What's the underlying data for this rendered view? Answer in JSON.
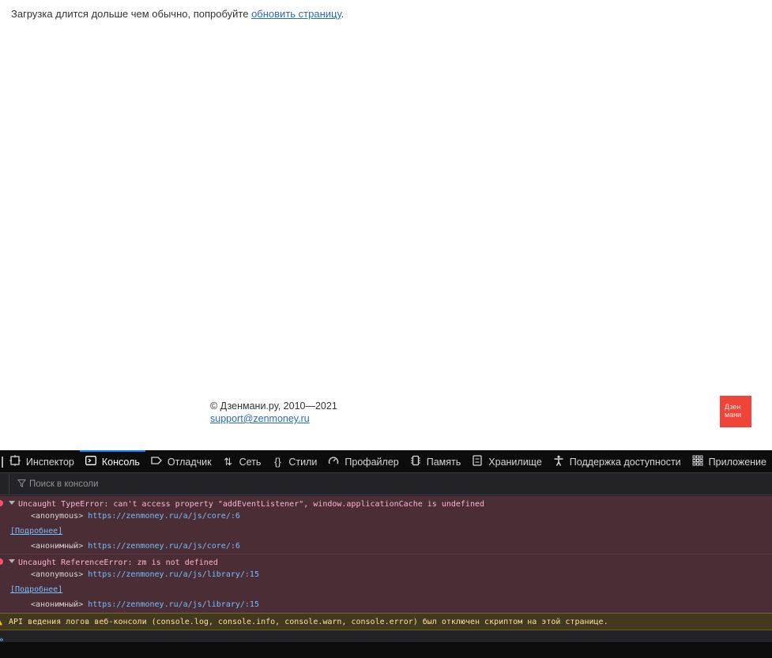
{
  "page": {
    "loading_text": "Загрузка длится дольше чем обычно, попробуйте ",
    "reload_link": "обновить страницу",
    "loading_suffix": ".",
    "footer_copyright": "© Дзенмани.ру, 2010—2021",
    "footer_email": "support@zenmoney.ru",
    "logo_line1": "Дзен",
    "logo_line2": "мани"
  },
  "devtools": {
    "tabs": [
      {
        "label": "Инспектор",
        "icon": "inspector-icon"
      },
      {
        "label": "Консоль",
        "icon": "console-icon",
        "active": true
      },
      {
        "label": "Отладчик",
        "icon": "debugger-icon"
      },
      {
        "label": "Сеть",
        "icon": "network-icon"
      },
      {
        "label": "Стили",
        "icon": "style-editor-icon"
      },
      {
        "label": "Профайлер",
        "icon": "profiler-icon"
      },
      {
        "label": "Память",
        "icon": "memory-icon"
      },
      {
        "label": "Хранилище",
        "icon": "storage-icon"
      },
      {
        "label": "Поддержка доступности",
        "icon": "accessibility-icon"
      },
      {
        "label": "Приложение",
        "icon": "application-icon"
      }
    ],
    "filter_placeholder": "Поиск в консоли",
    "messages": [
      {
        "type": "error",
        "text": "Uncaught TypeError: can't access property \"addEventListener\", window.applicationCache is undefined",
        "frame1_name": "<anonymous>",
        "frame1_url": "https://zenmoney.ru/a/js/core/:6",
        "more": "[Подробнее]",
        "frame2_name": "<анонимный>",
        "frame2_url": "https://zenmoney.ru/a/js/core/:6"
      },
      {
        "type": "error",
        "text": "Uncaught ReferenceError: zm is not defined",
        "frame1_name": "<anonymous>",
        "frame1_url": "https://zenmoney.ru/a/js/library/:15",
        "more": "[Подробнее]",
        "frame2_name": "<анонимный>",
        "frame2_url": "https://zenmoney.ru/a/js/library/:15"
      }
    ],
    "warning": "API ведения логов веб-консоли (console.log, console.info, console.warn, console.error) был отключен скриптом на этой странице.",
    "prompt": "»"
  },
  "colors": {
    "accent": "#0a84ff",
    "error_bg": "#4b2d35",
    "warning_bg": "#42381e",
    "link": "#75bfff",
    "logo_bg": "#f04438"
  }
}
